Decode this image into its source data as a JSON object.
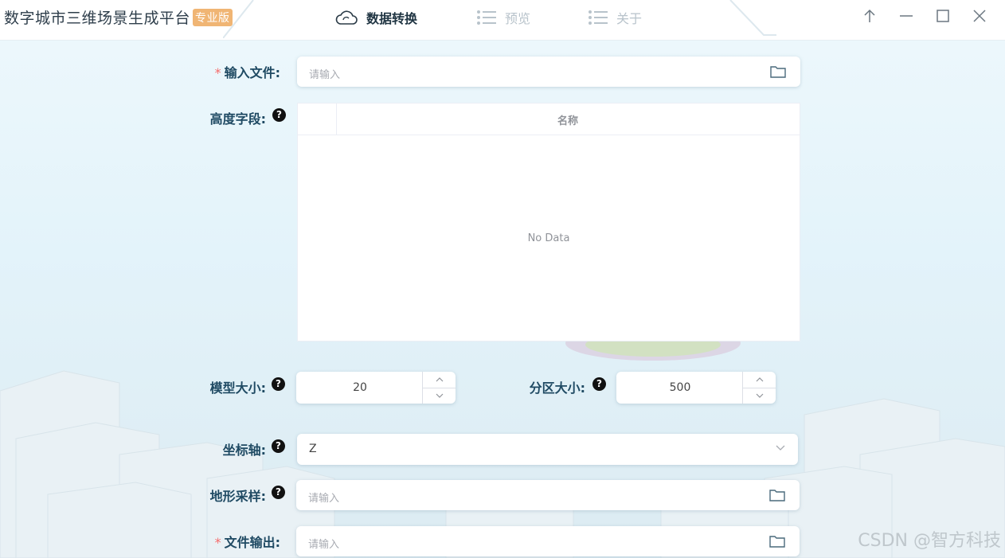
{
  "window": {
    "app_title": "数字城市三维场景生成平台",
    "edition_badge": "专业版"
  },
  "tabs": [
    {
      "label": "数据转换",
      "icon": "cloud-icon",
      "active": true
    },
    {
      "label": "预览",
      "icon": "list-icon",
      "active": false
    },
    {
      "label": "关于",
      "icon": "list-icon",
      "active": false
    }
  ],
  "window_controls": [
    "arrow-up-icon",
    "minimize-icon",
    "maximize-icon",
    "close-icon"
  ],
  "form": {
    "input_file": {
      "label": "输入文件:",
      "required": true,
      "placeholder": "请输入"
    },
    "height_field": {
      "label": "高度字段:",
      "table": {
        "columns": [
          "",
          "名称"
        ],
        "empty_text": "No Data"
      }
    },
    "model_size": {
      "label": "模型大小:",
      "value": "20"
    },
    "partition_size": {
      "label": "分区大小:",
      "value": "500"
    },
    "axis": {
      "label": "坐标轴:",
      "value": "Z"
    },
    "terrain_sampling": {
      "label": "地形采样:",
      "placeholder": "请输入"
    },
    "file_output": {
      "label": "文件输出:",
      "required": true,
      "placeholder": "请输入"
    }
  },
  "watermark": "CSDN @智方科技",
  "colors": {
    "accent": "#1f4a63",
    "badge": "#f0b574",
    "required": "#f56c6c"
  }
}
